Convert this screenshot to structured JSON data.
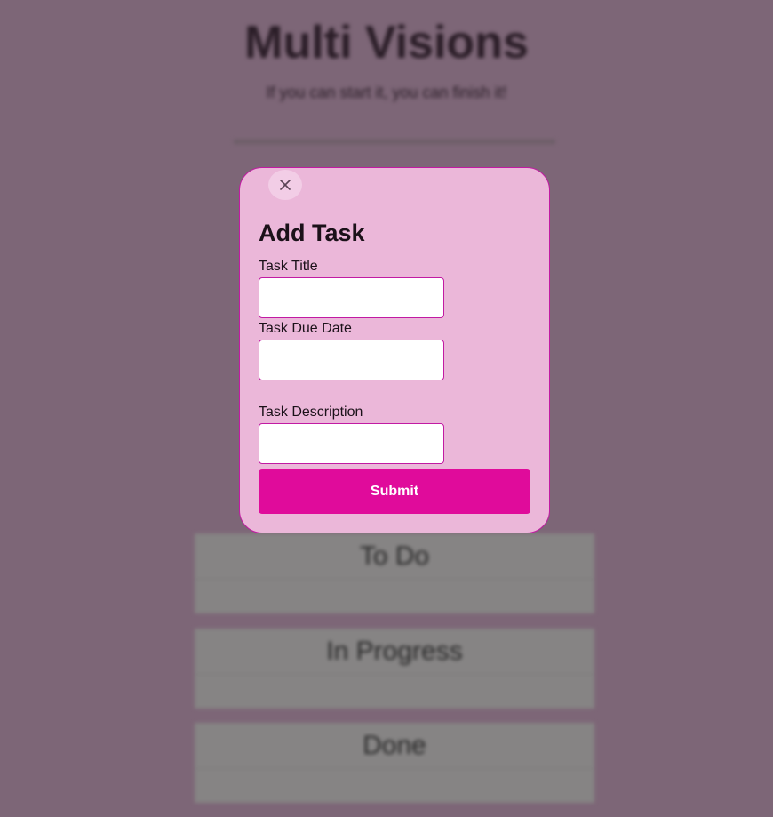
{
  "site": {
    "title": "Multi Visions",
    "tagline": "If you can start it, you can finish it!"
  },
  "columns": [
    {
      "title": "To Do"
    },
    {
      "title": "In Progress"
    },
    {
      "title": "Done"
    }
  ],
  "modal": {
    "close_icon": "close-icon",
    "title": "Add Task",
    "fields": {
      "task_title": {
        "label": "Task Title",
        "value": "",
        "placeholder": ""
      },
      "task_due_date": {
        "label": "Task Due Date",
        "value": "",
        "placeholder": ""
      },
      "task_description": {
        "label": "Task Description",
        "value": "",
        "placeholder": ""
      }
    },
    "submit_label": "Submit"
  },
  "colors": {
    "overlay_bg": "#7d6677",
    "modal_bg": "#ebb7d9",
    "accent": "#e00b9b",
    "border": "#c21aa3"
  }
}
